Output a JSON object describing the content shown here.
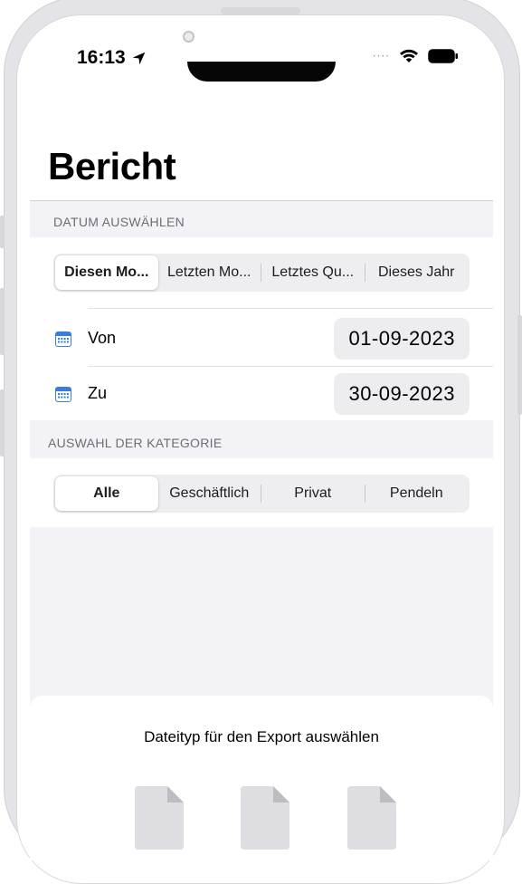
{
  "status_bar": {
    "time": "16:13",
    "signal_dots": "····"
  },
  "header": {
    "title": "Bericht"
  },
  "date_section": {
    "header": "DATUM AUSWÄHLEN",
    "segments": [
      "Diesen Mo...",
      "Letzten Mo...",
      "Letztes Qu...",
      "Dieses Jahr"
    ],
    "selected_index": 0,
    "from_label": "Von",
    "from_value": "01-09-2023",
    "to_label": "Zu",
    "to_value": "30-09-2023"
  },
  "category_section": {
    "header": "AUSWAHL DER KATEGORIE",
    "segments": [
      "Alle",
      "Geschäftlich",
      "Privat",
      "Pendeln"
    ],
    "selected_index": 0
  },
  "export": {
    "title": "Dateityp für den Export auswählen",
    "file_icons": [
      "document-icon",
      "document-icon",
      "document-icon"
    ]
  },
  "colors": {
    "background": "#f2f2f7",
    "card": "#ffffff",
    "accent_calendar": "#3b7ddd",
    "secondary_text": "#6d6d72"
  }
}
